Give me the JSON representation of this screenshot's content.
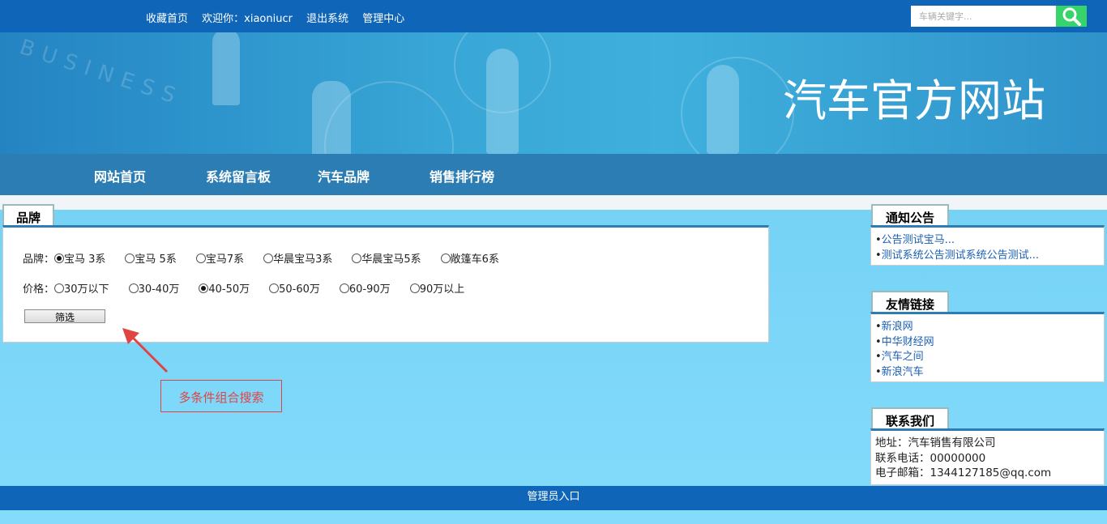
{
  "topbar": {
    "links": [
      "收藏首页",
      "欢迎你：xiaoniucr",
      "退出系统",
      "管理中心"
    ],
    "search_placeholder": "车辆关键字..."
  },
  "banner": {
    "title": "汽车官方网站",
    "bg_text": "BUSINESS"
  },
  "nav": {
    "items": [
      "网站首页",
      "系统留言板",
      "汽车品牌",
      "销售排行榜"
    ]
  },
  "brand_panel": {
    "tab_label": "品牌",
    "brand_label": "品牌：",
    "brand_options": [
      "宝马 3系",
      "宝马 5系",
      "宝马7系",
      "华晨宝马3系",
      "华晨宝马5系",
      "敞篷车6系"
    ],
    "brand_selected": 0,
    "price_label": "价格：",
    "price_options": [
      "30万以下",
      "30-40万",
      "40-50万",
      "50-60万",
      "60-90万",
      "90万以上"
    ],
    "price_selected": 2,
    "filter_button": "筛选"
  },
  "annotation": {
    "text": "多条件组合搜索",
    "color": "#e04545"
  },
  "notice": {
    "title": "通知公告",
    "items": [
      "公告测试宝马...",
      "测试系统公告测试系统公告测试..."
    ]
  },
  "links": {
    "title": "友情链接",
    "items": [
      "新浪网",
      "中华财经网",
      "汽车之间",
      "新浪汽车"
    ]
  },
  "contact": {
    "title": "联系我们",
    "address": "地址：汽车销售有限公司",
    "phone": "联系电话：00000000",
    "email": "电子邮箱：1344127185@qq.com"
  },
  "footer": {
    "admin_link": "管理员入口"
  },
  "colors": {
    "topbar": "#0f66b8",
    "nav": "#2c7db4",
    "search_button": "#37d46c",
    "link": "#1a5fb4"
  }
}
